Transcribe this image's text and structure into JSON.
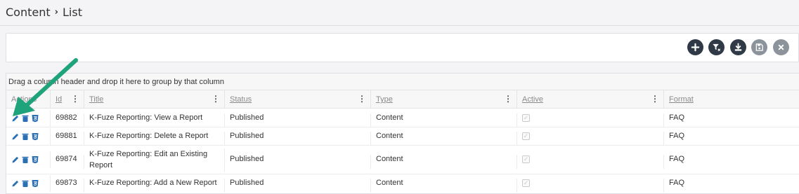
{
  "breadcrumb": {
    "section": "Content",
    "page": "List"
  },
  "toolbar": {
    "buttons": [
      {
        "name": "add-button",
        "icon": "plus-icon"
      },
      {
        "name": "clear-filter-button",
        "icon": "filter-clear-icon"
      },
      {
        "name": "download-button",
        "icon": "download-icon"
      },
      {
        "name": "save-button",
        "icon": "save-icon"
      },
      {
        "name": "close-button",
        "icon": "close-icon"
      }
    ]
  },
  "grid": {
    "group_hint": "Drag a column header and drop it here to group by that column",
    "columns": {
      "actions": "Actions",
      "id": "Id",
      "title": "Title",
      "status": "Status",
      "type": "Type",
      "active": "Active",
      "format": "Format"
    },
    "rows": [
      {
        "id": "69882",
        "title": "K-Fuze Reporting: View a Report",
        "status": "Published",
        "type": "Content",
        "active": true,
        "format": "FAQ"
      },
      {
        "id": "69881",
        "title": "K-Fuze Reporting: Delete a Report",
        "status": "Published",
        "type": "Content",
        "active": true,
        "format": "FAQ"
      },
      {
        "id": "69874",
        "title_line1": "K-Fuze Reporting: Edit an Existing",
        "title_line2": "Report",
        "status": "Published",
        "type": "Content",
        "active": true,
        "format": "FAQ"
      },
      {
        "id": "69873",
        "title": "K-Fuze Reporting: Add a New Report",
        "status": "Published",
        "type": "Content",
        "active": true,
        "format": "FAQ"
      }
    ]
  },
  "colors": {
    "toolbar_dark": "#2f3a46",
    "toolbar_disabled": "#8c939b",
    "action_icon": "#2a6fb3",
    "annotation_arrow": "#1fa37a"
  },
  "row_action_icons": [
    "pencil-icon",
    "trash-icon",
    "html5-icon"
  ]
}
